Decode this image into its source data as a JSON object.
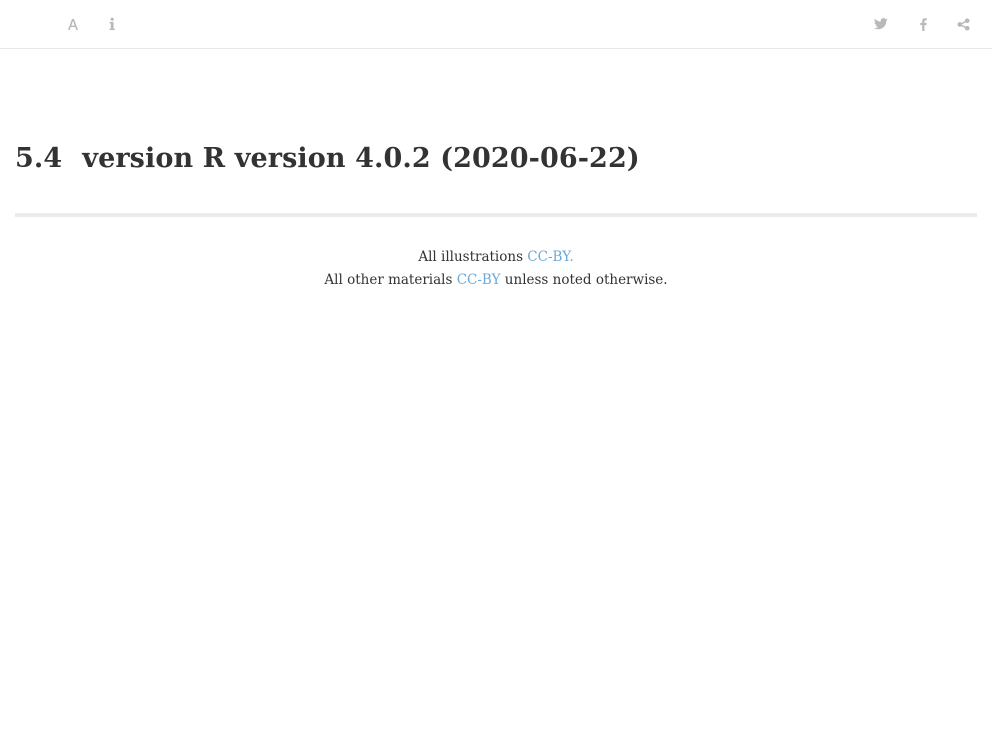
{
  "toolbar": {
    "left_buttons": [
      {
        "icon": "font-icon",
        "label": "Font settings"
      },
      {
        "icon": "info-icon",
        "label": "Information"
      }
    ],
    "right_buttons": [
      {
        "icon": "twitter-icon",
        "label": "Twitter"
      },
      {
        "icon": "facebook-icon",
        "label": "Facebook"
      },
      {
        "icon": "share-icon",
        "label": "Share"
      }
    ],
    "icon_color": "#b9b9b9"
  },
  "section": {
    "number": "5.4",
    "title": "version R version 4.0.2 (2020-06-22)"
  },
  "footer": {
    "line1_text": "All illustrations ",
    "line1_link": "CC-BY.",
    "line2_text": "All other materials ",
    "line2_link": "CC-BY",
    "line2_suffix": " unless noted otherwise.",
    "link_color": "#6aa9d8"
  }
}
